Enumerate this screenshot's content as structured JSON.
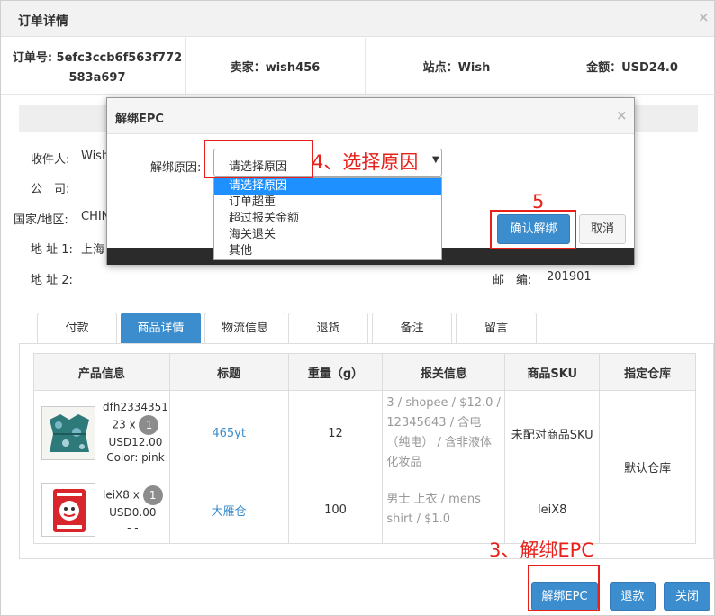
{
  "window": {
    "title": "订单详情",
    "close": "×"
  },
  "order_info": {
    "order_no_label": "订单号:",
    "order_no": "5efc3ccb6f563f772583a697",
    "seller": "卖家：wish456",
    "site": "站点：Wish",
    "amount": "金额：USD24.0"
  },
  "receiver": {
    "name_label": "收件人:",
    "name": "Wish",
    "company_label": "公　司:",
    "country_label": "国家/地区:",
    "country": "CHIN",
    "addr1_label": "地 址 1:",
    "addr1": "上海",
    "addr2_label": "地 址 2:",
    "postal_label": "邮　编:",
    "postal": "201901"
  },
  "tabs": [
    "付款",
    "商品详情",
    "物流信息",
    "退货",
    "备注",
    "留言"
  ],
  "active_tab": "商品详情",
  "table": {
    "headers": [
      "产品信息",
      "标题",
      "重量（g）",
      "报关信息",
      "商品SKU",
      "指定仓库"
    ],
    "rows": [
      {
        "product_id": "dfh2334351",
        "product_id_cont": "23 x",
        "qty": "1",
        "price": "USD12.00",
        "color": "Color:  pink",
        "title": "465yt",
        "weight": "12",
        "customs": "3 / shopee / $12.0 / 12345643 / 含电（纯电） / 含非液体化妆品",
        "sku": "未配对商品SKU"
      },
      {
        "product_id": "leiX8 x",
        "qty": "1",
        "price": "USD0.00",
        "extra": "- -",
        "title": "大雁仓",
        "weight": "100",
        "customs": "男士 上衣 / mens shirt / $1.0",
        "sku": "leiX8"
      }
    ],
    "warehouse": "默认仓库"
  },
  "buttons": {
    "unbind": "解绑EPC",
    "refund": "退款",
    "close": "关闭"
  },
  "modal": {
    "title": "解绑EPC",
    "close": "×",
    "reason_label": "解绑原因:",
    "selected": "请选择原因",
    "options": [
      "请选择原因",
      "订单超重",
      "超过报关金额",
      "海关退关",
      "其他"
    ],
    "confirm": "确认解绑",
    "cancel": "取消"
  },
  "annotations": {
    "step3": "3、解绑EPC",
    "step4": "4、选择原因",
    "step5": "5"
  },
  "colors": {
    "primary": "#3c8dcd",
    "annotation": "#e8201a",
    "highlight": "#1e90ff"
  }
}
